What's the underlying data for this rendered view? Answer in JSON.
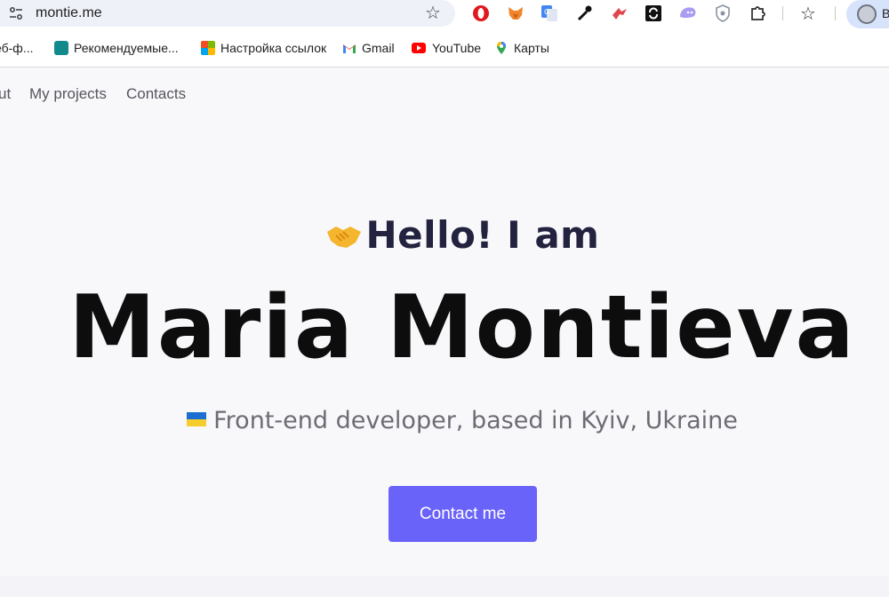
{
  "browser": {
    "url": "montie.me",
    "profile_letter": "B"
  },
  "bookmarks": [
    {
      "label": "еб-ф...",
      "icon": "bookmark-icon"
    },
    {
      "label": "Рекомендуемые...",
      "icon": "bing-icon"
    },
    {
      "label": "Настройка ссылок",
      "icon": "microsoft-icon"
    },
    {
      "label": "Gmail",
      "icon": "gmail-icon"
    },
    {
      "label": "YouTube",
      "icon": "youtube-icon"
    },
    {
      "label": "Карты",
      "icon": "maps-icon"
    }
  ],
  "nav": {
    "about": "ut",
    "projects": "My projects",
    "contacts": "Contacts"
  },
  "hero": {
    "greeting": "Hello! I am",
    "name": "Maria Montieva",
    "subtitle": "Front-end developer, based in Kyiv, Ukraine",
    "cta_label": "Contact me"
  },
  "colors": {
    "accent": "#6a63fa",
    "heading": "#23233f",
    "background": "#f8f8fb"
  }
}
